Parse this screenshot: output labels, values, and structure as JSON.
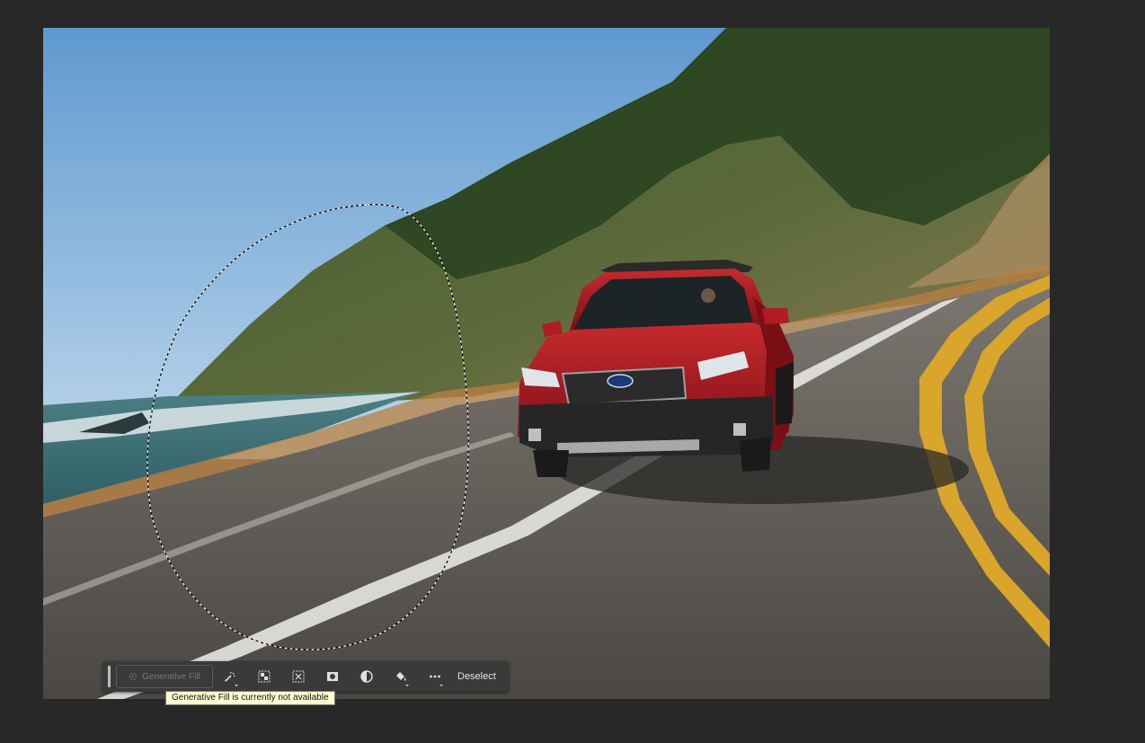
{
  "canvas": {
    "image_subject": "red-suv-on-coastal-road-photo",
    "selection": "lasso-selection-marquee"
  },
  "taskbar": {
    "generative_fill_label": "Generative Fill",
    "generative_fill_enabled": false,
    "tools": [
      {
        "name": "modify-selection-icon",
        "has_menu": true
      },
      {
        "name": "select-subject-icon",
        "has_menu": false
      },
      {
        "name": "select-background-icon",
        "has_menu": false
      },
      {
        "name": "create-mask-icon",
        "has_menu": false
      },
      {
        "name": "adjustment-layer-icon",
        "has_menu": false
      },
      {
        "name": "fill-bucket-icon",
        "has_menu": true
      },
      {
        "name": "more-options-icon",
        "has_menu": true
      }
    ],
    "deselect_label": "Deselect"
  },
  "tooltip": {
    "text": "Generative Fill is currently not available"
  },
  "colors": {
    "workspace_bg": "#282828",
    "taskbar_bg": "#3a3a3a",
    "tooltip_bg": "#ffffd2",
    "car_red": "#a8161f"
  }
}
